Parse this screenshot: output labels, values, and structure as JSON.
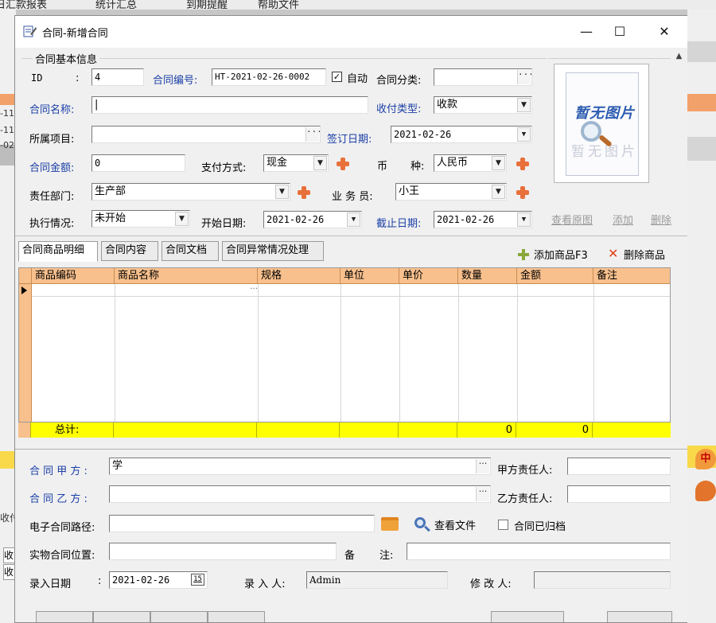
{
  "background": {
    "menu": [
      "日汇款报表",
      "统计汇总",
      "到期提醒",
      "帮助文件"
    ],
    "left_texts": [
      "-11",
      "-11",
      "-02",
      "收付",
      "收",
      "收"
    ],
    "badge": "中"
  },
  "window": {
    "title": "合同-新增合同",
    "minimize": "—",
    "maximize": "☐",
    "close": "✕"
  },
  "basic": {
    "section_title": "合同基本信息",
    "id_label": "ID",
    "id_colon": ":",
    "id_value": "4",
    "code_label": "合同编号:",
    "code_value": "HT-2021-02-26-0002",
    "auto_checked": "✓",
    "auto_label": "自动",
    "category_label": "合同分类:",
    "category_value": "",
    "name_label": "合同名称:",
    "name_value": "|",
    "pay_type_label": "收付类型:",
    "pay_type_value": "收款",
    "project_label": "所属项目:",
    "project_value": "",
    "sign_date_label": "签订日期:",
    "sign_date_value": "2021-02-26",
    "amount_label": "合同金额:",
    "amount_value": "0",
    "pay_method_label": "支付方式:",
    "pay_method_value": "现金",
    "currency_label_1": "币",
    "currency_label_2": "种:",
    "currency_value": "人民币",
    "dept_label": "责任部门:",
    "dept_value": "生产部",
    "staff_label": "业 务 员:",
    "staff_value": "小王",
    "status_label": "执行情况:",
    "status_value": "未开始",
    "start_label": "开始日期:",
    "start_value": "2021-02-26",
    "end_label": "截止日期:",
    "end_value": "2021-02-26"
  },
  "picture": {
    "placeholder_title": "暂无图片",
    "placeholder_sub": "暂无图片",
    "view_link": "查看原图",
    "add_link": "添加",
    "delete_link": "删除"
  },
  "tabs": [
    "合同商品明细",
    "合同内容",
    "合同文档",
    "合同异常情况处理"
  ],
  "toolbar": {
    "add_product": "添加商品F3",
    "delete_product": "删除商品"
  },
  "grid": {
    "columns": [
      "商品编码",
      "商品名称",
      "规格",
      "单位",
      "单价",
      "数量",
      "金额",
      "备注"
    ],
    "row_ellipsis": "…",
    "total_label": "总计:",
    "total_qty": "0",
    "total_amount": "0"
  },
  "parties": {
    "party_a_label": "合 同 甲 方 :",
    "party_a_value": "学",
    "party_a_rep_label": "甲方责任人:",
    "party_a_rep_value": "",
    "party_b_label": "合 同 乙 方 :",
    "party_b_value": "",
    "party_b_rep_label": "乙方责任人:",
    "party_b_rep_value": ""
  },
  "bottom": {
    "epath_label": "电子合同路径:",
    "epath_value": "",
    "view_file": "查看文件",
    "archived_label": "合同已归档",
    "physical_label": "实物合同位置:",
    "physical_value": "",
    "remark_label_1": "备",
    "remark_label_2": "注:",
    "remark_value": "",
    "entry_date_label": "录入日期",
    "entry_colon": ":",
    "entry_date_value": "2021-02-26",
    "calendar_icon": "15",
    "entry_user_label": "录 入 人:",
    "entry_user_value": "Admin",
    "modifier_label": "修 改 人:",
    "modifier_value": ""
  },
  "colors": {
    "label_blue": "#1a3fa6",
    "grid_header": "#f8c08d",
    "total_row": "#ffff00",
    "plus_orange": "#e8703a"
  }
}
